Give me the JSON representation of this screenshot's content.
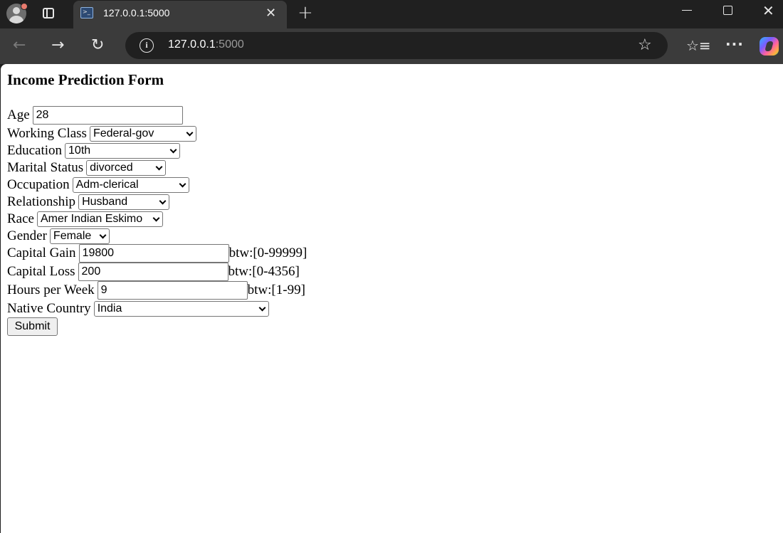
{
  "browser": {
    "tab_title": "127.0.0.1:5000",
    "tab_close_glyph": "✕",
    "new_tab_glyph": "+",
    "window_close_glyph": "✕",
    "url_host": "127.0.0.1",
    "url_port": ":5000",
    "icons": {
      "profile": "avatar-icon",
      "tab_actions": "tab-actions-icon",
      "favicon": "terminal-icon",
      "back": "arrow-left-icon",
      "forward": "arrow-right-icon",
      "refresh": "refresh-icon",
      "info": "info-icon",
      "favorite": "star-icon",
      "favorites": "favorites-list-icon",
      "more": "ellipsis-icon",
      "copilot": "copilot-icon"
    },
    "glyphs": {
      "back": "←",
      "forward": "→",
      "refresh": "↻",
      "info": "i",
      "star": "☆",
      "favorites": "☆≡",
      "more": "···"
    }
  },
  "form": {
    "title": "Income Prediction Form",
    "fields": {
      "age": {
        "label": "Age",
        "value": "28"
      },
      "working_class": {
        "label": "Working Class",
        "value": "Federal-gov"
      },
      "education": {
        "label": "Education",
        "value": "10th"
      },
      "marital_status": {
        "label": "Marital Status",
        "value": "divorced"
      },
      "occupation": {
        "label": "Occupation",
        "value": "Adm-clerical"
      },
      "relationship": {
        "label": "Relationship",
        "value": "Husband"
      },
      "race": {
        "label": "Race",
        "value": "Amer Indian Eskimo"
      },
      "gender": {
        "label": "Gender",
        "value": "Female"
      },
      "capital_gain": {
        "label": "Capital Gain",
        "value": "19800",
        "hint": "btw:[0-99999]"
      },
      "capital_loss": {
        "label": "Capital Loss",
        "value": "200",
        "hint": "btw:[0-4356]"
      },
      "hours_per_week": {
        "label": "Hours per Week",
        "value": "9",
        "hint": "btw:[1-99]"
      },
      "native_country": {
        "label": "Native Country",
        "value": "India"
      }
    },
    "submit_label": "Submit"
  }
}
